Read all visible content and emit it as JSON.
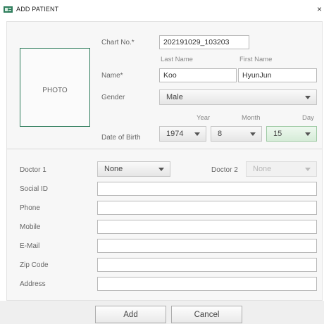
{
  "window": {
    "title": "ADD PATIENT",
    "close": "×"
  },
  "photo": {
    "label": "PHOTO"
  },
  "chart_no": {
    "label": "Chart No.*",
    "value": "202191029_103203"
  },
  "name": {
    "label": "Name*",
    "last_label": "Last Name",
    "first_label": "First Name",
    "last_value": "Koo",
    "first_value": "HyunJun"
  },
  "gender": {
    "label": "Gender",
    "value": "Male"
  },
  "dob": {
    "label": "Date of Birth",
    "year_label": "Year",
    "month_label": "Month",
    "day_label": "Day",
    "year": "1974",
    "month": "8",
    "day": "15"
  },
  "doctor1": {
    "label": "Doctor 1",
    "value": "None"
  },
  "doctor2": {
    "label": "Doctor 2",
    "value": "None"
  },
  "fields": {
    "social_id": {
      "label": "Social ID",
      "value": ""
    },
    "phone": {
      "label": "Phone",
      "value": ""
    },
    "mobile": {
      "label": "Mobile",
      "value": ""
    },
    "email": {
      "label": "E-Mail",
      "value": ""
    },
    "zip": {
      "label": "Zip Code",
      "value": ""
    },
    "address": {
      "label": "Address",
      "value": ""
    }
  },
  "buttons": {
    "add": "Add",
    "cancel": "Cancel"
  },
  "colors": {
    "accent_green": "#2f7d5c",
    "day_select": "#d6ecd8"
  }
}
